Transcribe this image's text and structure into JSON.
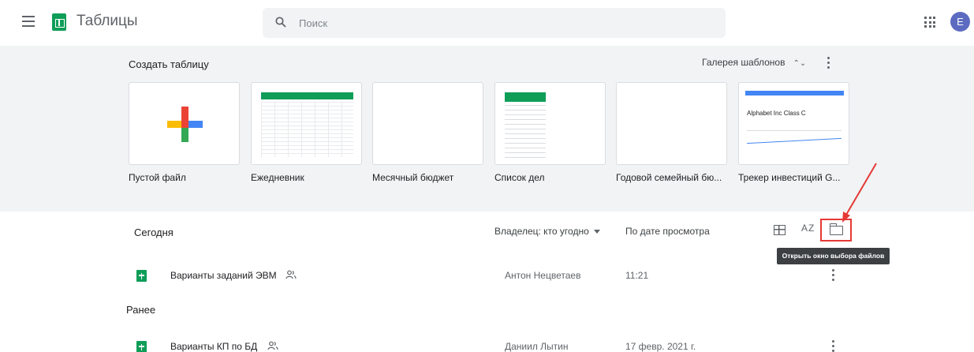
{
  "header": {
    "app_title": "Таблицы",
    "search_placeholder": "Поиск",
    "avatar_letter": "E"
  },
  "templates": {
    "title": "Создать таблицу",
    "gallery_label": "Галерея шаблонов",
    "items": [
      {
        "label": "Пустой файл"
      },
      {
        "label": "Ежедневник"
      },
      {
        "label": "Месячный бюджет"
      },
      {
        "label": "Список дел"
      },
      {
        "label": "Годовой семейный бю..."
      },
      {
        "label": "Трекер инвестиций G..."
      }
    ],
    "investment_thumb_title": "Alphabet Inc Class C"
  },
  "files": {
    "today_label": "Сегодня",
    "earlier_label": "Ранее",
    "owner_filter": "Владелец: кто угодно",
    "sort_label": "По дате просмотра",
    "sort_az": "AZ",
    "tooltip": "Открыть окно выбора файлов",
    "rows": [
      {
        "name": "Варианты заданий ЭВМ",
        "owner": "Антон Нецветаев",
        "date": "11:21"
      },
      {
        "name": "Варианты КП по БД",
        "owner": "Даниил Лытин",
        "date": "17 февр. 2021 г."
      }
    ]
  },
  "colors": {
    "accent": "#0f9d58",
    "highlight": "#e53935",
    "avatar": "#5c6bc0"
  }
}
